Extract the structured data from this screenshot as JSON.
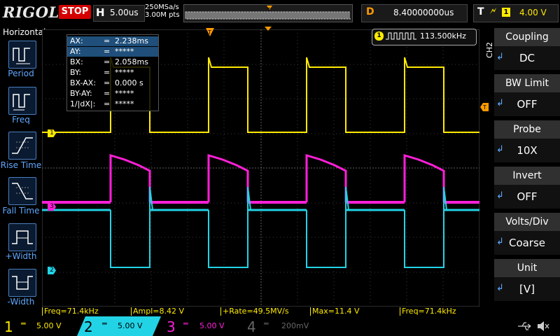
{
  "top": {
    "brand": "RIGOL",
    "run_state": "STOP",
    "horizontal_letter": "H",
    "timebase": "5.00us",
    "sample_rate": "250MSa/s",
    "mem_depth": "3.00M pts",
    "delay_letter": "D",
    "delay": "8.40000000us",
    "trigger_letter": "T",
    "trigger_edge": "rising",
    "trigger_source": "1",
    "trigger_level": "4.00 V"
  },
  "left_menu": {
    "title": "Horizontal",
    "items": [
      {
        "label": "Period",
        "icon": "period-icon"
      },
      {
        "label": "Freq",
        "icon": "freq-icon"
      },
      {
        "label": "Rise Time",
        "icon": "rise-time-icon"
      },
      {
        "label": "Fall Time",
        "icon": "fall-time-icon"
      },
      {
        "label": "+Width",
        "icon": "pos-width-icon"
      },
      {
        "label": "-Width",
        "icon": "neg-width-icon"
      }
    ]
  },
  "right_menu": {
    "channel_tag": "CH2",
    "items": [
      {
        "title": "Coupling",
        "value": "DC"
      },
      {
        "title": "BW Limit",
        "value": "OFF"
      },
      {
        "title": "Probe",
        "value": "10X"
      },
      {
        "title": "Invert",
        "value": "OFF"
      },
      {
        "title": "Volts/Div",
        "value": "Coarse"
      },
      {
        "title": "Unit",
        "value": "[V]"
      }
    ]
  },
  "cursor_readout": {
    "rows": [
      {
        "label": "AX:",
        "eq": "=",
        "value": "2.238ms"
      },
      {
        "label": "AY:",
        "eq": "=",
        "value": "*****"
      },
      {
        "label": "BX:",
        "eq": "=",
        "value": "2.058ms"
      },
      {
        "label": "BY:",
        "eq": "=",
        "value": "*****"
      },
      {
        "label": "BX-AX:",
        "eq": "=",
        "value": "0.000 s"
      },
      {
        "label": "BY-AY:",
        "eq": "=",
        "value": "*****"
      },
      {
        "label": "1/|dX|:",
        "eq": "=",
        "value": "*****"
      }
    ]
  },
  "freq_counter": {
    "channel": "1",
    "value": "113.500kHz"
  },
  "measurements": [
    {
      "text": "Freq=71.4kHz"
    },
    {
      "text": "Ampl=8.42 V"
    },
    {
      "text": "+Rate=49.5MV/s"
    },
    {
      "text": "Max=11.4 V"
    },
    {
      "text": "Freq=71.4kHz"
    }
  ],
  "channels": [
    {
      "num": "1",
      "scale": "5.00 V",
      "color": "#ffea00"
    },
    {
      "num": "2",
      "scale": "5.00 V",
      "color": "#22d3e6"
    },
    {
      "num": "3",
      "scale": "5.00 V",
      "color": "#ff1fd8"
    },
    {
      "num": "4",
      "scale": "200mV",
      "color": "#555555"
    }
  ],
  "trace_markers": [
    {
      "label": "1",
      "color": "#ffea00"
    },
    {
      "label": "3",
      "color": "#ff1fd8"
    },
    {
      "label": "2",
      "color": "#22d3e6"
    }
  ],
  "colors": {
    "ch1": "#ffea00",
    "ch2": "#22d3e6",
    "ch3": "#ff1fd8",
    "trigger": "#ff9a00",
    "stop": "#d40000"
  }
}
